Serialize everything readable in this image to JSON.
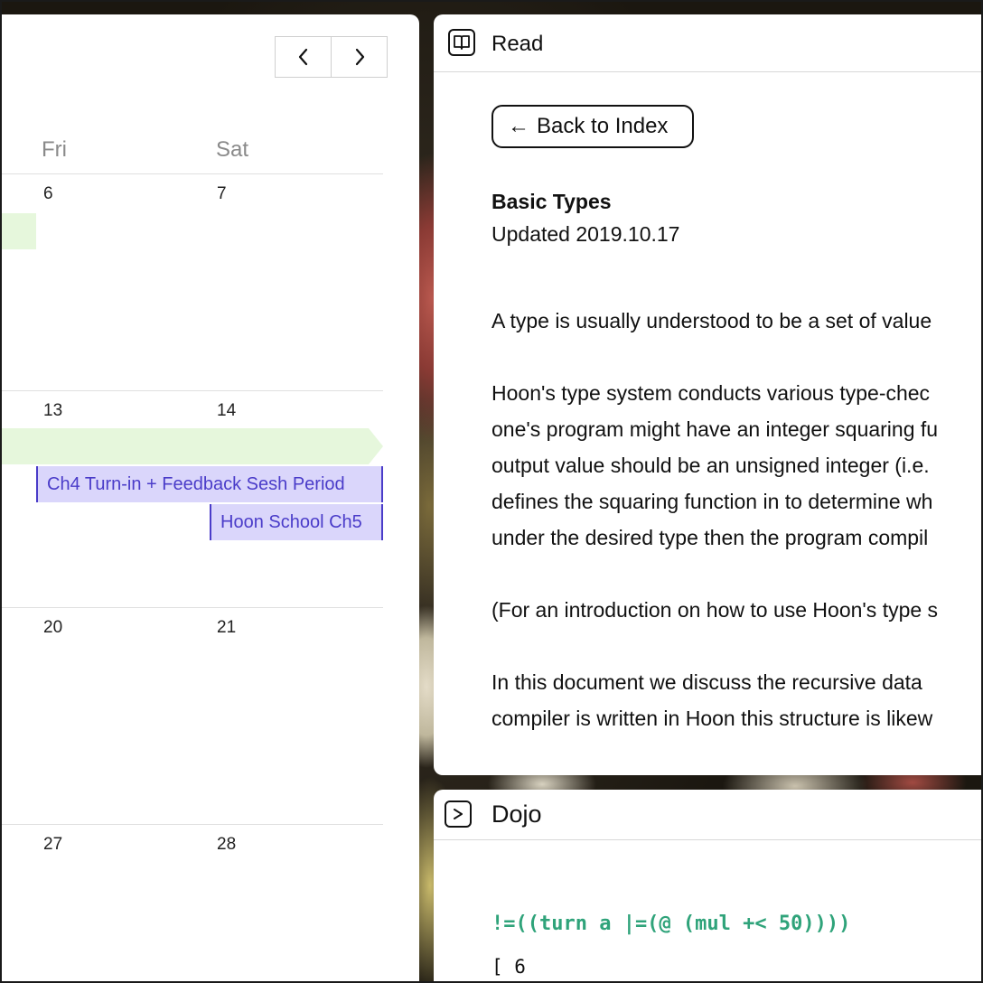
{
  "calendar": {
    "nav": {
      "prev_icon": "chevron-left-icon",
      "next_icon": "chevron-right-icon"
    },
    "days_of_week": [
      "Fri",
      "Sat"
    ],
    "weeks": [
      {
        "days": [
          "6",
          "7"
        ]
      },
      {
        "days": [
          "13",
          "14"
        ]
      },
      {
        "days": [
          "20",
          "21"
        ]
      },
      {
        "days": [
          "27",
          "28"
        ]
      }
    ],
    "events": [
      {
        "label": "Ch4 Turn-in + Feedback Sesh Period",
        "color": "#dad6fb",
        "text_color": "#4a3cc9"
      },
      {
        "label": "Hoon School Ch5",
        "color": "#dad6fb",
        "text_color": "#4a3cc9"
      }
    ],
    "spanning_event_color": "#e6f7dc"
  },
  "read_window": {
    "icon": "book-icon",
    "title": "Read",
    "back_button": {
      "arrow": "←",
      "label": "Back to Index"
    },
    "doc_title": "Basic Types",
    "doc_updated": "Updated 2019.10.17",
    "paragraphs": [
      [
        "A type is usually understood to be a set of value"
      ],
      [
        "Hoon's type system conducts various type-chec",
        "one's program might have an integer squaring fu",
        "output value should be an unsigned integer (i.e.",
        "defines the squaring function in to determine wh",
        "under the desired type then the program compil"
      ],
      [
        "(For an introduction on how to use Hoon's type s"
      ],
      [
        "In this document we discuss the recursive data",
        "compiler is written in Hoon this structure is likew"
      ]
    ]
  },
  "dojo_window": {
    "icon": "terminal-prompt-icon",
    "title": "Dojo",
    "command": "!=((turn a |=(@ (mul +< 50))))",
    "output": "[ 6",
    "command_color": "#2fa37a"
  }
}
